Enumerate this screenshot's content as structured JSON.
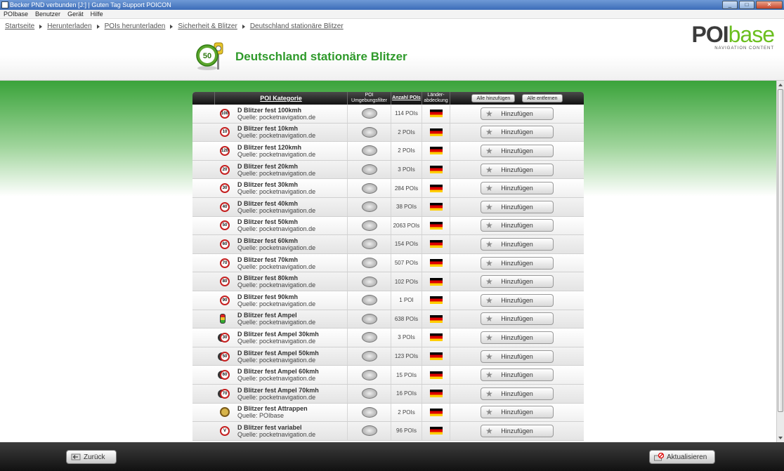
{
  "window": {
    "title": "Becker PND verbunden [J:] | Guten Tag Support POICON",
    "controls": [
      "_",
      "□",
      "✕"
    ]
  },
  "menu": [
    "POIbase",
    "Benutzer",
    "Gerät",
    "Hilfe"
  ],
  "breadcrumb": [
    "Startseite",
    "Herunterladen",
    "POIs herunterladen",
    "Sicherheit & Blitzer",
    "Deutschland stationäre Blitzer"
  ],
  "logo": {
    "poi": "POI",
    "base": "base",
    "tagline": "NAVIGATION CONTENT"
  },
  "page": {
    "title": "Deutschland stationäre Blitzer",
    "icon_number": "50"
  },
  "table": {
    "headers": {
      "category": "POI Kategorie",
      "filter": "POI Umgebungsfilter",
      "count": "Anzahl POIs",
      "coverage": "Länder-abdeckung",
      "add_all": "Alle hinzufügen",
      "remove_all": "Alle entfernen"
    },
    "add_label": "Hinzufügen",
    "rows": [
      {
        "sign": "100",
        "kind": "limit",
        "name": "D Blitzer fest 100kmh",
        "source": "Quelle: pocketnavigation.de",
        "count": "114 POIs"
      },
      {
        "sign": "10",
        "kind": "limit",
        "name": "D Blitzer fest 10kmh",
        "source": "Quelle: pocketnavigation.de",
        "count": "2 POIs"
      },
      {
        "sign": "120",
        "kind": "limit",
        "name": "D Blitzer fest 120kmh",
        "source": "Quelle: pocketnavigation.de",
        "count": "2 POIs"
      },
      {
        "sign": "20",
        "kind": "limit",
        "name": "D Blitzer fest 20kmh",
        "source": "Quelle: pocketnavigation.de",
        "count": "3 POIs"
      },
      {
        "sign": "30",
        "kind": "limit",
        "name": "D Blitzer fest 30kmh",
        "source": "Quelle: pocketnavigation.de",
        "count": "284 POIs"
      },
      {
        "sign": "40",
        "kind": "limit",
        "name": "D Blitzer fest 40kmh",
        "source": "Quelle: pocketnavigation.de",
        "count": "38 POIs"
      },
      {
        "sign": "50",
        "kind": "limit",
        "name": "D Blitzer fest 50kmh",
        "source": "Quelle: pocketnavigation.de",
        "count": "2063 POIs"
      },
      {
        "sign": "60",
        "kind": "limit",
        "name": "D Blitzer fest 60kmh",
        "source": "Quelle: pocketnavigation.de",
        "count": "154 POIs"
      },
      {
        "sign": "70",
        "kind": "limit",
        "name": "D Blitzer fest 70kmh",
        "source": "Quelle: pocketnavigation.de",
        "count": "507 POIs"
      },
      {
        "sign": "80",
        "kind": "limit",
        "name": "D Blitzer fest 80kmh",
        "source": "Quelle: pocketnavigation.de",
        "count": "102 POIs"
      },
      {
        "sign": "90",
        "kind": "limit",
        "name": "D Blitzer fest 90kmh",
        "source": "Quelle: pocketnavigation.de",
        "count": "1 POI"
      },
      {
        "sign": "",
        "kind": "light",
        "name": "D Blitzer fest Ampel",
        "source": "Quelle: pocketnavigation.de",
        "count": "638 POIs"
      },
      {
        "sign": "30",
        "kind": "combo",
        "name": "D Blitzer fest Ampel 30kmh",
        "source": "Quelle: pocketnavigation.de",
        "count": "3 POIs"
      },
      {
        "sign": "50",
        "kind": "combo",
        "name": "D Blitzer fest Ampel 50kmh",
        "source": "Quelle: pocketnavigation.de",
        "count": "123 POIs"
      },
      {
        "sign": "60",
        "kind": "combo",
        "name": "D Blitzer fest Ampel 60kmh",
        "source": "Quelle: pocketnavigation.de",
        "count": "15 POIs"
      },
      {
        "sign": "70",
        "kind": "combo",
        "name": "D Blitzer fest Ampel 70kmh",
        "source": "Quelle: pocketnavigation.de",
        "count": "16 POIs"
      },
      {
        "sign": "",
        "kind": "dummy",
        "name": "D Blitzer fest Attrappen",
        "source": "Quelle: POIbase",
        "count": "2 POIs"
      },
      {
        "sign": "V",
        "kind": "limit",
        "name": "D Blitzer fest variabel",
        "source": "Quelle: pocketnavigation.de",
        "count": "96 POIs"
      }
    ]
  },
  "footer": {
    "back": "Zurück",
    "refresh": "Aktualisieren"
  },
  "colors": {
    "accent_green": "#2f9a2b",
    "flag": [
      "#000000",
      "#dd0000",
      "#ffce00"
    ]
  }
}
